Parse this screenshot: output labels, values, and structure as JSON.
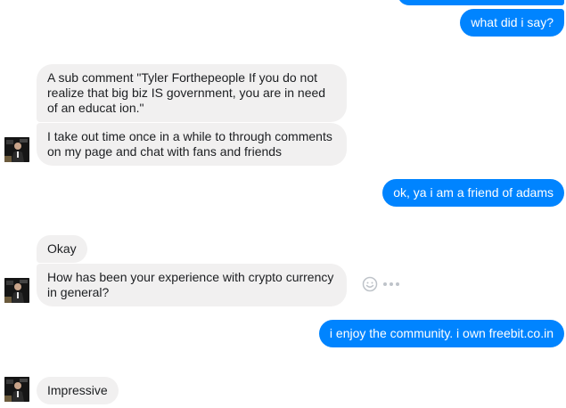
{
  "messages": {
    "m1": "what did i say?",
    "m2": "A sub comment \"Tyler Forthepeople If you do not realize that big biz IS government, you are in need of an educat ion.\"",
    "m3": "I take out time once in a while to through comments on my page and chat with fans and friends",
    "m4": "ok, ya i am a friend of adams",
    "m5": "Okay",
    "m6": "How has been your experience with crypto currency in general?",
    "m7": "i enjoy the community. i own freebit.co.in",
    "m8": "Impressive"
  },
  "colors": {
    "outgoing": "#0084ff",
    "incoming": "#f1f0f0"
  },
  "icons": {
    "emoji": "smiley-face-icon",
    "more": "more-options-icon"
  }
}
